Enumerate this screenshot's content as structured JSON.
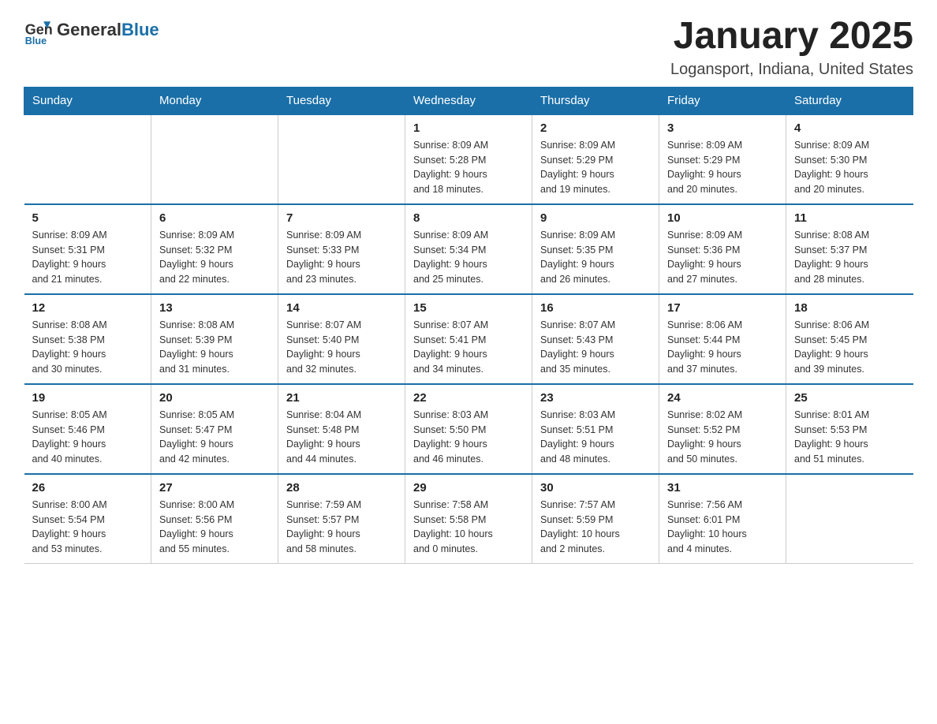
{
  "header": {
    "logo_general": "General",
    "logo_blue": "Blue",
    "month": "January 2025",
    "location": "Logansport, Indiana, United States"
  },
  "days_of_week": [
    "Sunday",
    "Monday",
    "Tuesday",
    "Wednesday",
    "Thursday",
    "Friday",
    "Saturday"
  ],
  "weeks": [
    [
      {
        "day": "",
        "info": ""
      },
      {
        "day": "",
        "info": ""
      },
      {
        "day": "",
        "info": ""
      },
      {
        "day": "1",
        "info": "Sunrise: 8:09 AM\nSunset: 5:28 PM\nDaylight: 9 hours\nand 18 minutes."
      },
      {
        "day": "2",
        "info": "Sunrise: 8:09 AM\nSunset: 5:29 PM\nDaylight: 9 hours\nand 19 minutes."
      },
      {
        "day": "3",
        "info": "Sunrise: 8:09 AM\nSunset: 5:29 PM\nDaylight: 9 hours\nand 20 minutes."
      },
      {
        "day": "4",
        "info": "Sunrise: 8:09 AM\nSunset: 5:30 PM\nDaylight: 9 hours\nand 20 minutes."
      }
    ],
    [
      {
        "day": "5",
        "info": "Sunrise: 8:09 AM\nSunset: 5:31 PM\nDaylight: 9 hours\nand 21 minutes."
      },
      {
        "day": "6",
        "info": "Sunrise: 8:09 AM\nSunset: 5:32 PM\nDaylight: 9 hours\nand 22 minutes."
      },
      {
        "day": "7",
        "info": "Sunrise: 8:09 AM\nSunset: 5:33 PM\nDaylight: 9 hours\nand 23 minutes."
      },
      {
        "day": "8",
        "info": "Sunrise: 8:09 AM\nSunset: 5:34 PM\nDaylight: 9 hours\nand 25 minutes."
      },
      {
        "day": "9",
        "info": "Sunrise: 8:09 AM\nSunset: 5:35 PM\nDaylight: 9 hours\nand 26 minutes."
      },
      {
        "day": "10",
        "info": "Sunrise: 8:09 AM\nSunset: 5:36 PM\nDaylight: 9 hours\nand 27 minutes."
      },
      {
        "day": "11",
        "info": "Sunrise: 8:08 AM\nSunset: 5:37 PM\nDaylight: 9 hours\nand 28 minutes."
      }
    ],
    [
      {
        "day": "12",
        "info": "Sunrise: 8:08 AM\nSunset: 5:38 PM\nDaylight: 9 hours\nand 30 minutes."
      },
      {
        "day": "13",
        "info": "Sunrise: 8:08 AM\nSunset: 5:39 PM\nDaylight: 9 hours\nand 31 minutes."
      },
      {
        "day": "14",
        "info": "Sunrise: 8:07 AM\nSunset: 5:40 PM\nDaylight: 9 hours\nand 32 minutes."
      },
      {
        "day": "15",
        "info": "Sunrise: 8:07 AM\nSunset: 5:41 PM\nDaylight: 9 hours\nand 34 minutes."
      },
      {
        "day": "16",
        "info": "Sunrise: 8:07 AM\nSunset: 5:43 PM\nDaylight: 9 hours\nand 35 minutes."
      },
      {
        "day": "17",
        "info": "Sunrise: 8:06 AM\nSunset: 5:44 PM\nDaylight: 9 hours\nand 37 minutes."
      },
      {
        "day": "18",
        "info": "Sunrise: 8:06 AM\nSunset: 5:45 PM\nDaylight: 9 hours\nand 39 minutes."
      }
    ],
    [
      {
        "day": "19",
        "info": "Sunrise: 8:05 AM\nSunset: 5:46 PM\nDaylight: 9 hours\nand 40 minutes."
      },
      {
        "day": "20",
        "info": "Sunrise: 8:05 AM\nSunset: 5:47 PM\nDaylight: 9 hours\nand 42 minutes."
      },
      {
        "day": "21",
        "info": "Sunrise: 8:04 AM\nSunset: 5:48 PM\nDaylight: 9 hours\nand 44 minutes."
      },
      {
        "day": "22",
        "info": "Sunrise: 8:03 AM\nSunset: 5:50 PM\nDaylight: 9 hours\nand 46 minutes."
      },
      {
        "day": "23",
        "info": "Sunrise: 8:03 AM\nSunset: 5:51 PM\nDaylight: 9 hours\nand 48 minutes."
      },
      {
        "day": "24",
        "info": "Sunrise: 8:02 AM\nSunset: 5:52 PM\nDaylight: 9 hours\nand 50 minutes."
      },
      {
        "day": "25",
        "info": "Sunrise: 8:01 AM\nSunset: 5:53 PM\nDaylight: 9 hours\nand 51 minutes."
      }
    ],
    [
      {
        "day": "26",
        "info": "Sunrise: 8:00 AM\nSunset: 5:54 PM\nDaylight: 9 hours\nand 53 minutes."
      },
      {
        "day": "27",
        "info": "Sunrise: 8:00 AM\nSunset: 5:56 PM\nDaylight: 9 hours\nand 55 minutes."
      },
      {
        "day": "28",
        "info": "Sunrise: 7:59 AM\nSunset: 5:57 PM\nDaylight: 9 hours\nand 58 minutes."
      },
      {
        "day": "29",
        "info": "Sunrise: 7:58 AM\nSunset: 5:58 PM\nDaylight: 10 hours\nand 0 minutes."
      },
      {
        "day": "30",
        "info": "Sunrise: 7:57 AM\nSunset: 5:59 PM\nDaylight: 10 hours\nand 2 minutes."
      },
      {
        "day": "31",
        "info": "Sunrise: 7:56 AM\nSunset: 6:01 PM\nDaylight: 10 hours\nand 4 minutes."
      },
      {
        "day": "",
        "info": ""
      }
    ]
  ]
}
